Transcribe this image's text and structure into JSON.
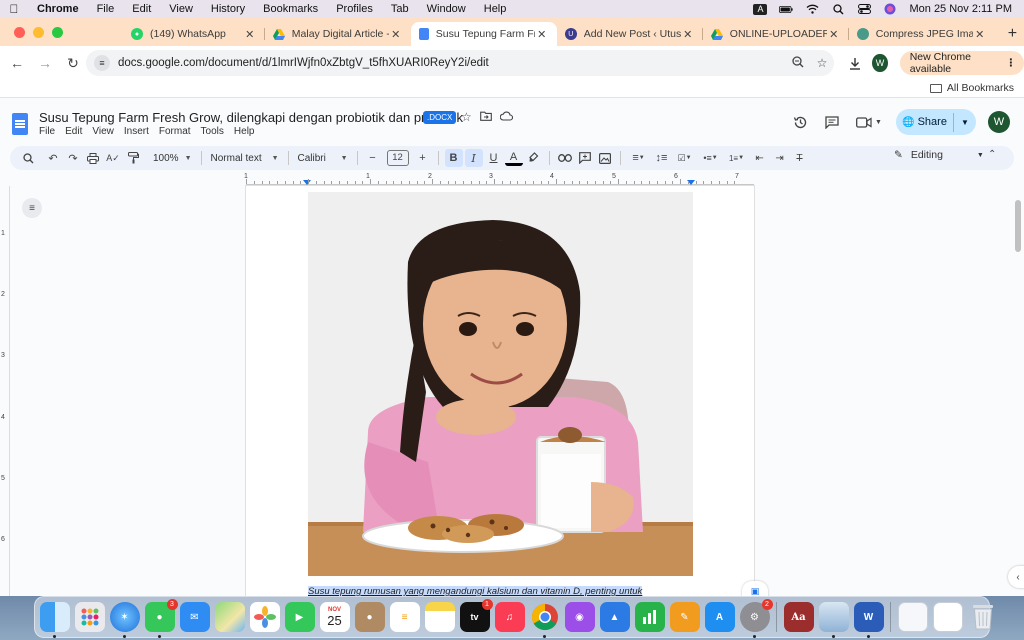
{
  "menubar": {
    "app": "Chrome",
    "items": [
      "File",
      "Edit",
      "View",
      "History",
      "Bookmarks",
      "Profiles",
      "Tab",
      "Window",
      "Help"
    ],
    "datetime": "Mon 25 Nov  2:11 PM"
  },
  "tabs": [
    {
      "title": "(149) WhatsApp",
      "favicon_color": "#25d366"
    },
    {
      "title": "Malay Digital Article - G",
      "favicon_color": "#fbbc04"
    },
    {
      "title": "Susu Tepung Farm Fres",
      "favicon_color": "#4285f4",
      "active": true
    },
    {
      "title": "Add New Post ‹ Utusan",
      "favicon_color": "#3b3b8f"
    },
    {
      "title": "ONLINE-UPLOADER - E",
      "favicon_color": "#fbbc04"
    },
    {
      "title": "Compress JPEG Images",
      "favicon_color": "#4a9a8a"
    }
  ],
  "address": {
    "url": "docs.google.com/document/d/1lmrIWjfn0xZbtgV_t5fhXUARI0ReyY2i/edit",
    "new_chrome": "New Chrome available",
    "profile_initial": "W"
  },
  "bookmarks": {
    "all": "All Bookmarks"
  },
  "doc": {
    "title": "Susu Tepung Farm Fresh Grow, dilengkapi dengan probiotik dan prebiotik",
    "badge": ".DOCX",
    "menu": [
      "File",
      "Edit",
      "View",
      "Insert",
      "Format",
      "Tools",
      "Help"
    ],
    "share": "Share",
    "user_initial": "W"
  },
  "toolbar": {
    "zoom": "100%",
    "style": "Normal text",
    "font": "Calibri",
    "font_size": "12",
    "bold": "B",
    "italic": "I",
    "underline": "U",
    "text_color": "A",
    "mode": "Editing"
  },
  "ruler": {
    "numbers": [
      "1",
      "1",
      "2",
      "3",
      "4",
      "5",
      "6",
      "7"
    ],
    "vertical_numbers": [
      "1",
      "2",
      "3",
      "4",
      "5",
      "6"
    ]
  },
  "content": {
    "caption": "Susu tepung rumusan yang mengandungi kalsium dan vitamin D, penting untuk"
  },
  "dock": {
    "messages_badge": "3",
    "calendar_month": "NOV",
    "calendar_day": "25",
    "appletv_badge": "1",
    "settings_badge": "2",
    "tv_label": "tv",
    "dictionary_label": "Aa",
    "word_label": "W"
  }
}
